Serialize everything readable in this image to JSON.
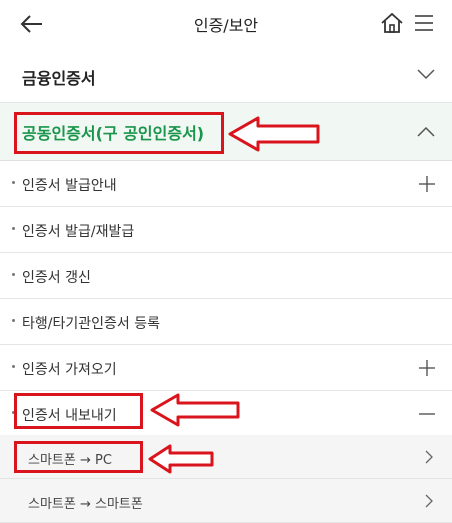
{
  "header": {
    "title": "인증/보안",
    "back_icon": "arrow-left-icon",
    "home_icon": "home-icon",
    "menu_icon": "hamburger-menu-icon"
  },
  "sections": [
    {
      "label": "금융인증서",
      "expanded": false
    },
    {
      "label": "공동인증서(구 공인인증서)",
      "expanded": true
    }
  ],
  "items": [
    {
      "label": "인증서 발급안내",
      "icon": "plus-icon"
    },
    {
      "label": "인증서 발급/재발급",
      "icon": ""
    },
    {
      "label": "인증서 갱신",
      "icon": ""
    },
    {
      "label": "타행/타기관인증서 등록",
      "icon": ""
    },
    {
      "label": "인증서 가져오기",
      "icon": "plus-icon"
    },
    {
      "label": "인증서 내보내기",
      "icon": "minus-icon"
    }
  ],
  "subitems": [
    {
      "label": "스마트폰 → PC"
    },
    {
      "label": "스마트폰 → 스마트폰"
    }
  ],
  "colors": {
    "accent_green": "#19964b",
    "annotation_red": "#d9141c",
    "expanded_bg": "#f1f7f3"
  }
}
